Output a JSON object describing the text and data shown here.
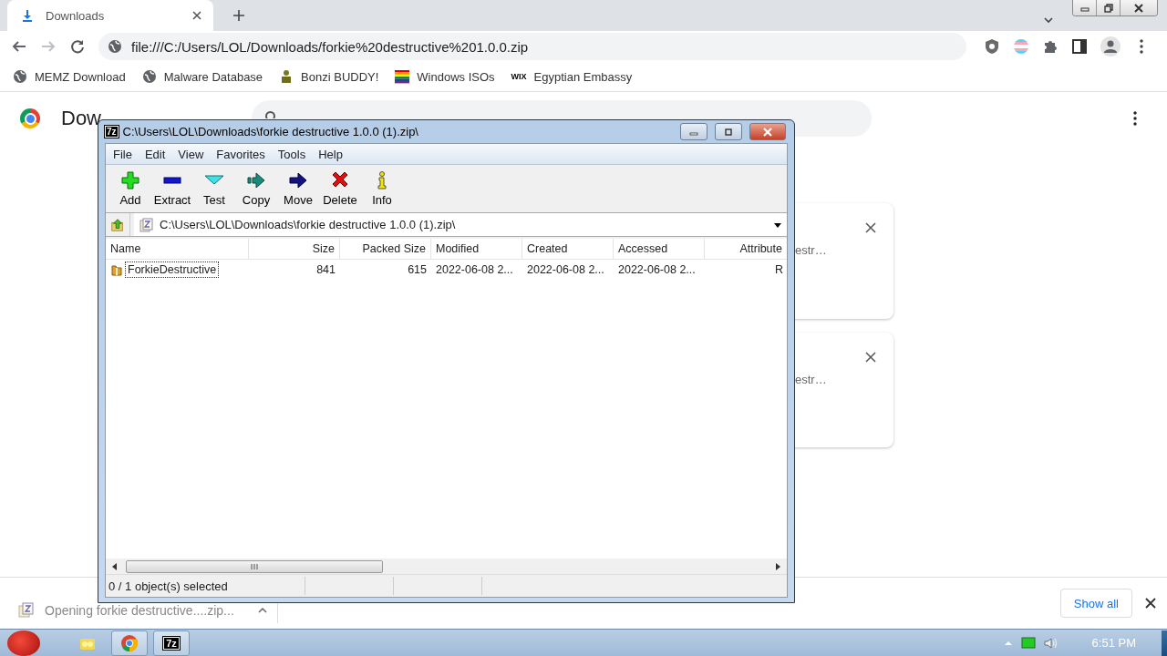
{
  "browser": {
    "tabs": [
      {
        "title": "Downloads",
        "selected": true
      }
    ],
    "nav": {
      "back_disabled": false,
      "forward_disabled": true
    },
    "url": "file:///C:/Users/LOL/Downloads/forkie%20destructive%201.0.0.zip",
    "bookmarks": [
      {
        "label": "MEMZ Download",
        "kind": "globe"
      },
      {
        "label": "Malware Database",
        "kind": "globe"
      },
      {
        "label": "Bonzi BUDDY!",
        "kind": "figure"
      },
      {
        "label": "Windows ISOs",
        "kind": "rainbow"
      },
      {
        "label": "Egyptian Embassy",
        "kind": "wix",
        "icon_text": "WIX"
      }
    ]
  },
  "page": {
    "title": "Dow",
    "cards": [
      {
        "text": "estr…"
      },
      {
        "text": "estr…"
      }
    ]
  },
  "shelf": {
    "item": "Opening forkie destructive....zip...",
    "show_all": "Show all"
  },
  "zip_window": {
    "icon_text": "7z",
    "title": "C:\\Users\\LOL\\Downloads\\forkie destructive 1.0.0 (1).zip\\",
    "menu": [
      "File",
      "Edit",
      "View",
      "Favorites",
      "Tools",
      "Help"
    ],
    "tools": [
      {
        "label": "Add",
        "kind": "add"
      },
      {
        "label": "Extract",
        "kind": "extract"
      },
      {
        "label": "Test",
        "kind": "test"
      },
      {
        "label": "Copy",
        "kind": "copy"
      },
      {
        "label": "Move",
        "kind": "move"
      },
      {
        "label": "Delete",
        "kind": "delete"
      },
      {
        "label": "Info",
        "kind": "info"
      }
    ],
    "path": "C:\\Users\\LOL\\Downloads\\forkie destructive 1.0.0 (1).zip\\",
    "columns": [
      {
        "label": "Name"
      },
      {
        "label": "Size"
      },
      {
        "label": "Packed Size"
      },
      {
        "label": "Modified"
      },
      {
        "label": "Created"
      },
      {
        "label": "Accessed"
      },
      {
        "label": "Attribute"
      }
    ],
    "rows": [
      {
        "cells": [
          "ForkieDestructive",
          "841",
          "615",
          "2022-06-08 2...",
          "2022-06-08 2...",
          "2022-06-08 2...",
          "R"
        ],
        "focused": true
      }
    ],
    "status": "0 / 1 object(s) selected"
  },
  "taskbar": {
    "apps": [
      {
        "kind": "explorer",
        "open": false
      },
      {
        "kind": "chrome",
        "open": true
      },
      {
        "kind": "sevenzip",
        "open": true,
        "label": "7z"
      }
    ],
    "time": "6:51 PM"
  }
}
